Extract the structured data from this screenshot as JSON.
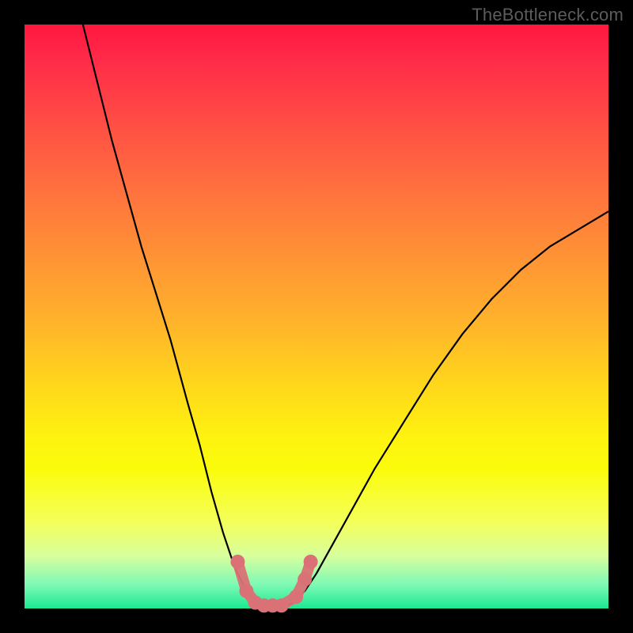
{
  "watermark": "TheBottleneck.com",
  "chart_data": {
    "type": "line",
    "title": "",
    "xlabel": "",
    "ylabel": "",
    "xlim": [
      0,
      100
    ],
    "ylim": [
      0,
      100
    ],
    "series": [
      {
        "name": "bottleneck-curve",
        "x": [
          10,
          15,
          20,
          25,
          28,
          30,
          32,
          34,
          36,
          38,
          40,
          42,
          44,
          46,
          48,
          50,
          55,
          60,
          65,
          70,
          75,
          80,
          85,
          90,
          95,
          100
        ],
        "y": [
          100,
          80,
          62,
          46,
          35,
          28,
          20,
          13,
          7,
          3,
          1,
          0,
          0,
          1,
          3,
          6,
          15,
          24,
          32,
          40,
          47,
          53,
          58,
          62,
          65,
          68
        ]
      }
    ],
    "markers": {
      "name": "recommended-range",
      "color": "#da7176",
      "points": [
        {
          "x": 36.5,
          "y": 8
        },
        {
          "x": 38,
          "y": 3
        },
        {
          "x": 39.5,
          "y": 1
        },
        {
          "x": 41,
          "y": 0.5
        },
        {
          "x": 42.5,
          "y": 0.5
        },
        {
          "x": 44,
          "y": 0.5
        },
        {
          "x": 46.5,
          "y": 2
        },
        {
          "x": 48,
          "y": 5
        },
        {
          "x": 49,
          "y": 8
        }
      ]
    },
    "gradient_stops": [
      {
        "pos": 0,
        "color": "#ff173f"
      },
      {
        "pos": 50,
        "color": "#ffb02c"
      },
      {
        "pos": 76,
        "color": "#fbfc0b"
      },
      {
        "pos": 100,
        "color": "#1ce891"
      }
    ]
  }
}
